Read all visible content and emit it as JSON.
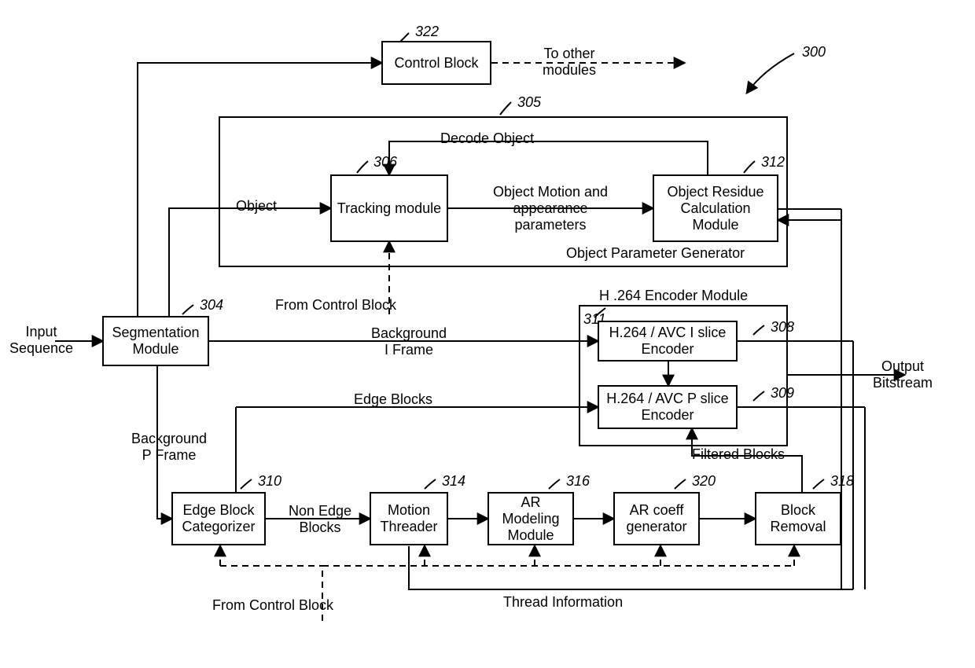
{
  "refs": {
    "system": "300",
    "control_block": "322",
    "opg": "305",
    "tracking": "306",
    "residue": "312",
    "segmentation": "304",
    "encoder_module": "311",
    "i_slice": "308",
    "p_slice": "309",
    "edge_categ": "310",
    "motion_threader": "314",
    "ar_model": "316",
    "ar_coeff": "320",
    "block_removal": "318"
  },
  "labels": {
    "input_sequence": "Input\nSequence",
    "output_bitstream": "Output\nBitstream",
    "control_block": "Control\nBlock",
    "to_other_modules": "To other\nmodules",
    "decode_object": "Decode Object",
    "tracking": "Tracking\nmodule",
    "object": "Object",
    "motion_appearance": "Object Motion and\nappearance\nparameters",
    "residue": "Object Residue\nCalculation\nModule",
    "opg": "Object Parameter Generator",
    "segmentation": "Segmentation\nModule",
    "from_control_block": "From Control Block",
    "from_control_block2": "From Control Block",
    "bg_i_frame": "Background\nI Frame",
    "encoder_module": "H .264 Encoder Module",
    "i_slice": "H.264 / AVC I\nslice Encoder",
    "p_slice": "H.264 / AVC P\nslice Encoder",
    "edge_blocks": "Edge Blocks",
    "filtered_blocks": "Filtered Blocks",
    "bg_p_frame": "Background\nP Frame",
    "edge_categ": "Edge Block\nCategorizer",
    "non_edge": "Non Edge\nBlocks",
    "motion_threader": "Motion\nThreader",
    "ar_model": "AR\nModeling\nModule",
    "ar_coeff": "AR coeff\ngenerator",
    "block_removal": "Block\nRemoval",
    "thread_info": "Thread Information"
  }
}
